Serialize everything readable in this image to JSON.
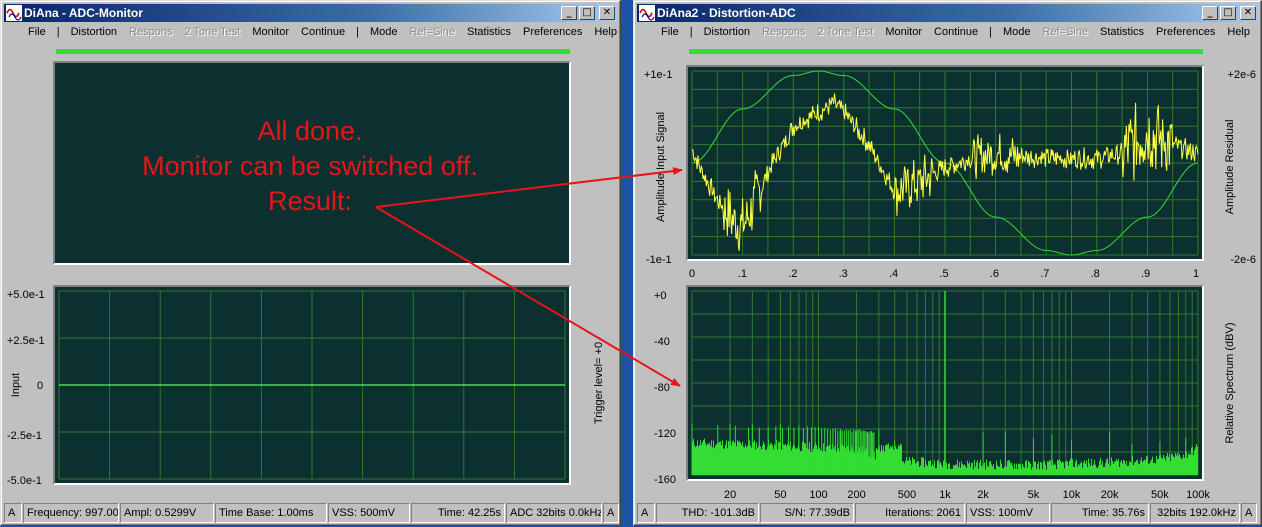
{
  "left": {
    "title": "DiAna - ADC-Monitor",
    "menu": [
      {
        "label": "File",
        "disabled": false
      },
      {
        "label": "|",
        "sep": true
      },
      {
        "label": "Distortion",
        "disabled": false
      },
      {
        "label": "Respons",
        "disabled": true
      },
      {
        "label": "2 Tone Test",
        "disabled": true
      },
      {
        "label": "Monitor",
        "disabled": false
      },
      {
        "label": "Continue",
        "disabled": false
      },
      {
        "label": "|",
        "sep": true
      },
      {
        "label": "Mode",
        "disabled": false
      },
      {
        "label": "Ref=Sine",
        "disabled": true
      },
      {
        "label": "Statistics",
        "disabled": false
      },
      {
        "label": "Preferences",
        "disabled": false
      },
      {
        "label": "Help",
        "disabled": false
      }
    ],
    "note_lines": [
      "All done.",
      "Monitor can be switched off.",
      "Result:"
    ],
    "input_y_ticks": [
      "+5.0e-1",
      "+2.5e-1",
      "0",
      "-2.5e-1",
      "-5.0e-1"
    ],
    "input_label": "Input",
    "trigger_label": "Trigger level=  +0",
    "status": {
      "a_left": "A",
      "frequency": "Frequency: 997.00",
      "ampl": "Ampl: 0.5299V",
      "timebase": "Time Base: 1.00ms",
      "vss": "VSS: 500mV",
      "time": "Time: 42.25s",
      "adc": "ADC 32bits 0.0kHz",
      "a_right": "A"
    }
  },
  "right": {
    "title": "DiAna2 - Distortion-ADC",
    "menu": [
      {
        "label": "File",
        "disabled": false
      },
      {
        "label": "|",
        "sep": true
      },
      {
        "label": "Distortion",
        "disabled": false
      },
      {
        "label": "Respons",
        "disabled": true
      },
      {
        "label": "2 Tone Test",
        "disabled": true
      },
      {
        "label": "Monitor",
        "disabled": false
      },
      {
        "label": "Continue",
        "disabled": false
      },
      {
        "label": "|",
        "sep": true
      },
      {
        "label": "Mode",
        "disabled": false
      },
      {
        "label": "Ref=Sine",
        "disabled": true
      },
      {
        "label": "Statistics",
        "disabled": false
      },
      {
        "label": "Preferences",
        "disabled": false
      },
      {
        "label": "Help",
        "disabled": false
      }
    ],
    "status": {
      "a_left": "A",
      "thd": "THD: -101.3dB",
      "sn": "S/N:  77.39dB",
      "iterations": "Iterations: 2061",
      "vss": "VSS: 100mV",
      "time": "Time: 35.76s",
      "adc": "32bits 192.0kHz",
      "a_right": "A"
    }
  },
  "chart_data": [
    {
      "type": "line",
      "title": "",
      "ylabel": "Amplitude Input Signal",
      "y2label": "Amplitude Residual",
      "x_ticks": [
        "0",
        ".1",
        ".2",
        ".3",
        ".4",
        ".5",
        ".6",
        ".7",
        ".8",
        ".9",
        "1"
      ],
      "xlim": [
        0,
        1
      ],
      "ylim": [
        -0.1,
        0.1
      ],
      "y_ticks_left": [
        "+1e-1",
        "-1e-1"
      ],
      "y2lim": [
        -2e-06,
        2e-06
      ],
      "y_ticks_right": [
        "+2e-6",
        "-2e-6"
      ],
      "grid": true,
      "series": [
        {
          "role": "input",
          "color": "#33dd33",
          "x": [
            0,
            0.1,
            0.2,
            0.25,
            0.3,
            0.4,
            0.5,
            0.6,
            0.7,
            0.75,
            0.8,
            0.9,
            1
          ],
          "y": [
            0,
            0.0588,
            0.0951,
            0.1,
            0.0951,
            0.0588,
            0,
            -0.0588,
            -0.0951,
            -0.1,
            -0.0951,
            -0.0588,
            0
          ]
        },
        {
          "role": "residual",
          "color": "#ffff44",
          "x": [
            0,
            0.02,
            0.05,
            0.08,
            0.1,
            0.15,
            0.2,
            0.25,
            0.28,
            0.3,
            0.35,
            0.4,
            0.45,
            0.5,
            0.55,
            0.6,
            0.7,
            0.8,
            0.85,
            0.9,
            0.95,
            1
          ],
          "y": [
            3e-07,
            -2e-07,
            -8e-07,
            -1.2e-06,
            -1.4e-06,
            -2e-07,
            8e-07,
            1.1e-06,
            1.3e-06,
            1.1e-06,
            4e-07,
            -6e-07,
            -4e-07,
            -1e-07,
            1e-07,
            2e-07,
            1e-07,
            1e-07,
            2e-07,
            7e-07,
            4e-07,
            2e-07
          ]
        }
      ]
    },
    {
      "type": "bar",
      "title": "",
      "ylabel": "Relative Spectrum (dBV)",
      "x_scale": "log",
      "xlim": [
        10,
        100000
      ],
      "x_ticks": [
        "20",
        "50",
        "100",
        "200",
        "500",
        "1k",
        "2k",
        "5k",
        "10k",
        "20k",
        "50k",
        "100k"
      ],
      "x_tick_values": [
        20,
        50,
        100,
        200,
        500,
        1000,
        2000,
        5000,
        10000,
        20000,
        50000,
        100000
      ],
      "ylim": [
        -160,
        0
      ],
      "y_ticks": [
        "+0",
        "-40",
        "-80",
        "-120",
        "-160"
      ],
      "grid": true,
      "color": "#33dd33",
      "fundamental": {
        "x": 1000,
        "y": 0
      },
      "noise_floor": [
        {
          "x": 10,
          "y": -134
        },
        {
          "x": 50,
          "y": -136
        },
        {
          "x": 100,
          "y": -138
        },
        {
          "x": 200,
          "y": -139
        },
        {
          "x": 300,
          "y": -146
        },
        {
          "x": 500,
          "y": -150
        },
        {
          "x": 1000,
          "y": -152
        },
        {
          "x": 5000,
          "y": -153
        },
        {
          "x": 20000,
          "y": -151
        },
        {
          "x": 50000,
          "y": -148
        },
        {
          "x": 80000,
          "y": -144
        },
        {
          "x": 100000,
          "y": -138
        }
      ],
      "spikes": [
        {
          "x": 10,
          "y": -115
        },
        {
          "x": 20,
          "y": -115
        },
        {
          "x": 30,
          "y": -116
        },
        {
          "x": 50,
          "y": -116
        },
        {
          "x": 70,
          "y": -117
        },
        {
          "x": 100,
          "y": -118
        },
        {
          "x": 150,
          "y": -120
        },
        {
          "x": 200,
          "y": -122
        },
        {
          "x": 300,
          "y": -120
        },
        {
          "x": 400,
          "y": -130
        },
        {
          "x": 2000,
          "y": -123
        },
        {
          "x": 3000,
          "y": -122
        },
        {
          "x": 5000,
          "y": -128
        },
        {
          "x": 7000,
          "y": -125
        },
        {
          "x": 10000,
          "y": -130
        },
        {
          "x": 20000,
          "y": -122
        },
        {
          "x": 30000,
          "y": -133
        },
        {
          "x": 50000,
          "y": -131
        },
        {
          "x": 80000,
          "y": -128
        }
      ]
    },
    {
      "type": "line",
      "title": "",
      "ylabel": "Input",
      "y_ticks": [
        "+5.0e-1",
        "+2.5e-1",
        "0",
        "-2.5e-1",
        "-5.0e-1"
      ],
      "ylim": [
        -0.5,
        0.5
      ],
      "grid": true,
      "series": [
        {
          "color": "#55ff55",
          "x": [
            0,
            1
          ],
          "y": [
            0,
            0
          ]
        }
      ]
    }
  ]
}
